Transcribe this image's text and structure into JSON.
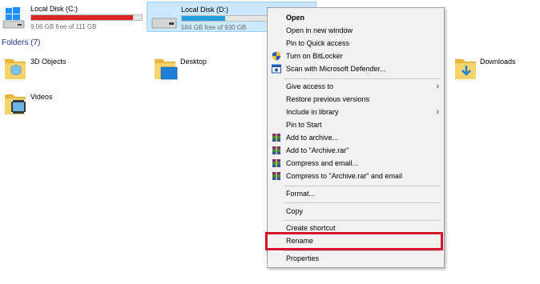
{
  "drives": [
    {
      "name": "Local Disk (C:)",
      "free_text": "9.06 GB free of 111 GB",
      "used_fraction": 0.92,
      "bar_color": "#da2626",
      "selected": false
    },
    {
      "name": "Local Disk (D:)",
      "free_text": "584 GB free of 930 GB",
      "used_fraction": 0.37,
      "bar_color": "#26a0da",
      "selected": true
    }
  ],
  "folders_header": "Folders (7)",
  "folders": [
    {
      "name": "3D Objects",
      "icon": "3d-objects-folder-icon"
    },
    {
      "name": "Desktop",
      "icon": "desktop-folder-icon"
    },
    {
      "name": "Downloads",
      "icon": "downloads-folder-icon"
    },
    {
      "name": "Videos",
      "icon": "videos-folder-icon"
    }
  ],
  "context_menu": {
    "items": [
      {
        "label": "Open",
        "bold": true
      },
      {
        "label": "Open in new window"
      },
      {
        "label": "Pin to Quick access"
      },
      {
        "label": "Turn on BitLocker",
        "icon": "shield-icon"
      },
      {
        "label": "Scan with Microsoft Defender...",
        "icon": "defender-icon"
      },
      {
        "label": "Give access to",
        "submenu": true
      },
      {
        "label": "Restore previous versions"
      },
      {
        "label": "Include in library",
        "submenu": true
      },
      {
        "label": "Pin to Start"
      },
      {
        "label": "Add to archive...",
        "icon": "winrar-icon"
      },
      {
        "label": "Add to \"Archive.rar\"",
        "icon": "winrar-icon"
      },
      {
        "label": "Compress and email...",
        "icon": "winrar-icon"
      },
      {
        "label": "Compress to \"Archive.rar\" and email",
        "icon": "winrar-icon"
      },
      {
        "label": "Format..."
      },
      {
        "label": "Copy"
      },
      {
        "label": "Create shortcut"
      },
      {
        "label": "Rename",
        "highlighted": true
      },
      {
        "label": "Properties"
      }
    ]
  },
  "colors": {
    "selection_bg": "#cce8ff",
    "highlight_border": "#d4152b",
    "section_title": "#1e3287"
  }
}
